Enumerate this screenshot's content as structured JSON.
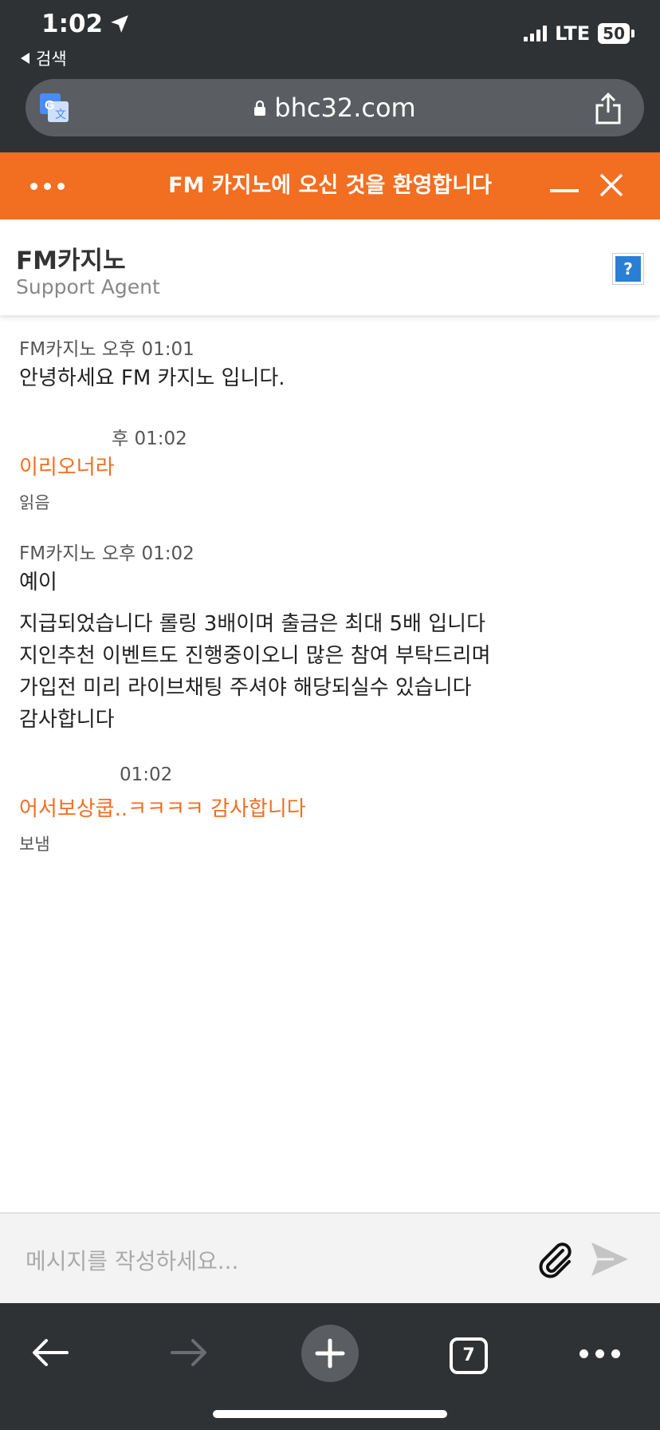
{
  "status_bar": {
    "time": "1:02",
    "back_app": "검색",
    "network": "LTE",
    "battery": "50"
  },
  "browser": {
    "url": "bhc32.com"
  },
  "chat_header": {
    "title": "FM 카지노에 오신 것을 환영합니다"
  },
  "agent": {
    "name": "FM카지노",
    "role": "Support Agent",
    "help_label": "?"
  },
  "messages": [
    {
      "meta": "FM카지노 오후 01:01",
      "lines": [
        "안녕하세요 FM 카지노 입니다."
      ]
    },
    {
      "meta": "후 01:02",
      "lines": [
        "이리오너라"
      ],
      "status": "읽음"
    },
    {
      "meta": "FM카지노 오후 01:02",
      "lines": [
        "예이"
      ]
    },
    {
      "lines": [
        "지급되었습니다 롤링 3배이며 출금은 최대 5배 입니다",
        "지인추천 이벤트도 진행중이오니 많은 참여 부탁드리며",
        "가입전 미리 라이브채팅 주셔야 해당되실수 있습니다",
        "감사합니다"
      ]
    },
    {
      "meta": "01:02",
      "lines": [
        "어서보상쿱..ㅋㅋㅋㅋ 감사합니다"
      ],
      "status": "보냄"
    }
  ],
  "input": {
    "placeholder": "메시지를 작성하세요..."
  },
  "toolbar": {
    "tab_count": "7"
  },
  "colors": {
    "accent": "#f26e21",
    "chrome": "#2f3235",
    "help_blue": "#2a7fd4"
  }
}
